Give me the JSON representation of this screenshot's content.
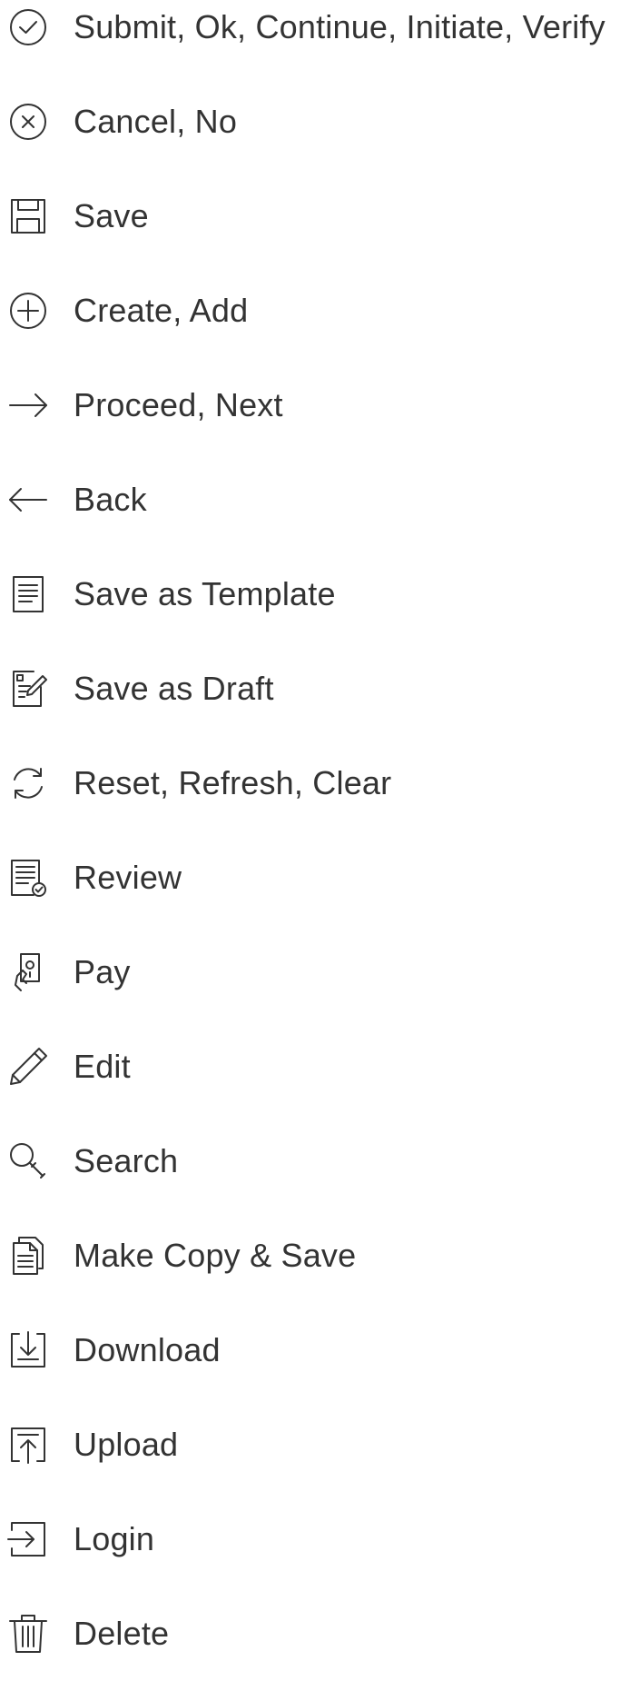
{
  "actions": [
    {
      "label": "Submit, Ok, Continue, Initiate, Verify",
      "icon": "check-circle-icon"
    },
    {
      "label": "Cancel, No",
      "icon": "close-circle-icon"
    },
    {
      "label": "Save",
      "icon": "floppy-disk-icon"
    },
    {
      "label": "Create, Add",
      "icon": "plus-circle-icon"
    },
    {
      "label": "Proceed, Next",
      "icon": "arrow-right-icon"
    },
    {
      "label": "Back",
      "icon": "arrow-left-icon"
    },
    {
      "label": "Save as Template",
      "icon": "template-document-icon"
    },
    {
      "label": "Save as Draft",
      "icon": "draft-document-icon"
    },
    {
      "label": "Reset, Refresh, Clear",
      "icon": "refresh-icon"
    },
    {
      "label": "Review",
      "icon": "review-document-icon"
    },
    {
      "label": "Pay",
      "icon": "pay-hand-icon"
    },
    {
      "label": "Edit",
      "icon": "pencil-icon"
    },
    {
      "label": "Search",
      "icon": "magnifier-icon"
    },
    {
      "label": "Make Copy & Save",
      "icon": "copy-document-icon"
    },
    {
      "label": "Download",
      "icon": "download-tray-icon"
    },
    {
      "label": "Upload",
      "icon": "upload-tray-icon"
    },
    {
      "label": "Login",
      "icon": "login-icon"
    },
    {
      "label": "Delete",
      "icon": "trash-icon"
    }
  ],
  "colors": {
    "text": "#333333",
    "icon": "#333333",
    "background": "#ffffff"
  }
}
